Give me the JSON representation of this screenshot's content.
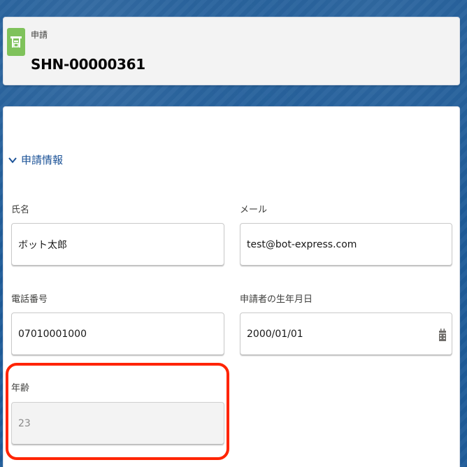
{
  "header": {
    "object_label": "申請",
    "record_name": "SHN-00000361",
    "icon": "record-icon"
  },
  "section": {
    "title": "申請情報",
    "toggle_icon": "chevron-down-icon"
  },
  "fields": {
    "name": {
      "label": "氏名",
      "value": "ボット太郎"
    },
    "email": {
      "label": "メール",
      "value": "test@bot-express.com"
    },
    "phone": {
      "label": "電話番号",
      "value": "07010001000"
    },
    "birthdate": {
      "label": "申請者の生年月日",
      "value": "2000/01/01",
      "icon": "calendar-icon"
    },
    "age": {
      "label": "年齢",
      "value": "23"
    }
  },
  "colors": {
    "accent": "#1b5297",
    "icon_green": "#7fc25b",
    "highlight": "#ff2400",
    "background": "#1f5c99"
  }
}
